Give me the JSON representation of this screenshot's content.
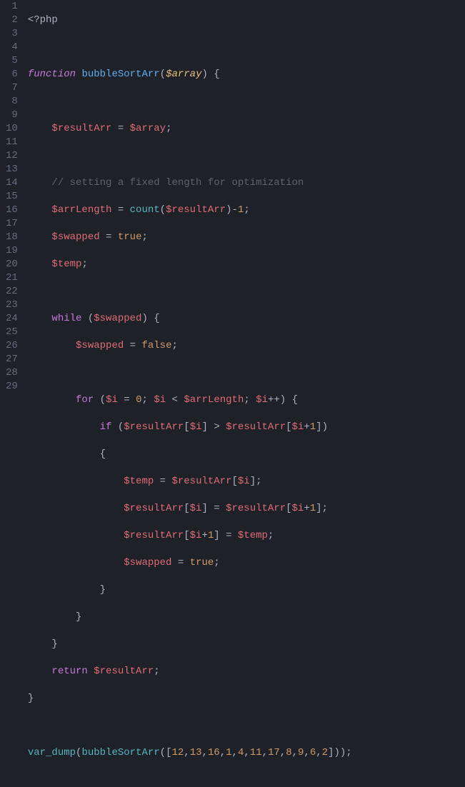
{
  "gutter": {
    "start": 1,
    "end": 29
  },
  "code": {
    "l1_open": "<?php",
    "l3_func": "function",
    "l3_name": "bubbleSortArr",
    "l3_param": "$array",
    "l5_var": "$resultArr",
    "l5_rhs": "$array",
    "l7_comment": "// setting a fixed length for optimization",
    "l8_var": "$arrLength",
    "l8_func": "count",
    "l8_arg": "$resultArr",
    "l8_minus": "1",
    "l9_var": "$swapped",
    "l9_true": "true",
    "l10_var": "$temp",
    "l12_while": "while",
    "l12_cond": "$swapped",
    "l13_var": "$swapped",
    "l13_false": "false",
    "l15_for": "for",
    "l15_i": "$i",
    "l15_zero": "0",
    "l15_i2": "$i",
    "l15_limit": "$arrLength",
    "l15_i3": "$i",
    "l16_if": "if",
    "l16_arr1": "$resultArr",
    "l16_idx1": "$i",
    "l16_arr2": "$resultArr",
    "l16_idx2a": "$i",
    "l16_idx2b": "1",
    "l18_temp": "$temp",
    "l18_arr": "$resultArr",
    "l18_idx": "$i",
    "l19_arr1": "$resultArr",
    "l19_idx1": "$i",
    "l19_arr2": "$resultArr",
    "l19_idx2a": "$i",
    "l19_idx2b": "1",
    "l20_arr": "$resultArr",
    "l20_idxa": "$i",
    "l20_idxb": "1",
    "l20_temp": "$temp",
    "l21_var": "$swapped",
    "l21_true": "true",
    "l25_return": "return",
    "l25_var": "$resultArr",
    "l28_dump": "var_dump",
    "l28_call": "bubbleSortArr",
    "l28_nums": [
      "12",
      "13",
      "16",
      "1",
      "4",
      "11",
      "17",
      "8",
      "9",
      "6",
      "2"
    ]
  },
  "chart_data": {
    "type": "table",
    "title": "PHP bubbleSortArr source listing",
    "lines": [
      "<?php",
      "",
      "function bubbleSortArr($array) {",
      "",
      "    $resultArr = $array;",
      "",
      "    // setting a fixed length for optimization",
      "    $arrLength = count($resultArr)-1;",
      "    $swapped = true;",
      "    $temp;",
      "",
      "    while ($swapped) {",
      "        $swapped = false;",
      "",
      "        for ($i = 0; $i < $arrLength; $i++) {",
      "            if ($resultArr[$i] > $resultArr[$i+1])",
      "            {",
      "                $temp = $resultArr[$i];",
      "                $resultArr[$i] = $resultArr[$i+1];",
      "                $resultArr[$i+1] = $temp;",
      "                $swapped = true;",
      "            }",
      "        }",
      "    }",
      "    return $resultArr;",
      "}",
      "",
      "var_dump(bubbleSortArr([12,13,16,1,4,11,17,8,9,6,2]));",
      ""
    ]
  }
}
